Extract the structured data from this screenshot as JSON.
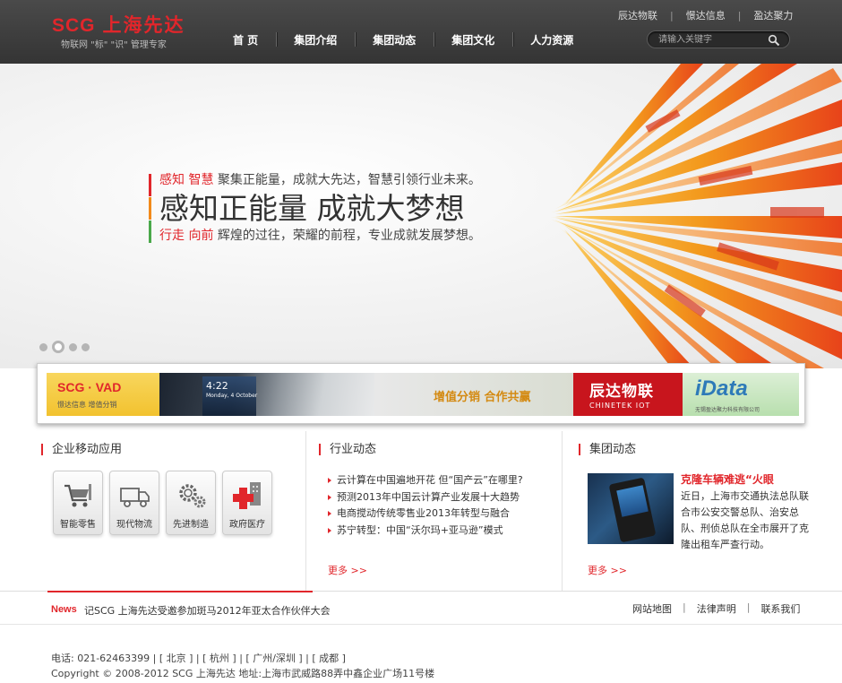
{
  "header": {
    "logo_main": "SCG",
    "logo_cn": "上海先达",
    "logo_sub": "物联网 \"标\" \"识\" 管理专家",
    "top_links": [
      "辰达物联",
      "憬达信息",
      "盈达聚力"
    ],
    "top_sep": "|",
    "nav": [
      "首 页",
      "集团介绍",
      "集团动态",
      "集团文化",
      "人力资源"
    ],
    "search_placeholder": "请输入关键字"
  },
  "banner": {
    "line1_red": "感知 智慧",
    "line1_rest": " 聚集正能量，成就大先达，智慧引领行业未来。",
    "line2": "感知正能量 成就大梦想",
    "line3_red": "行走 向前",
    "line3_rest": " 辉煌的过往，荣耀的前程，专业成就发展梦想。",
    "slide_count": 4,
    "active_slide": 2
  },
  "ad_strip": {
    "scg_line1": "SCG · VAD",
    "scg_line2": "憬达信息  增值分销",
    "phone_clock": "4:22",
    "phone_date": "Monday, 4 October",
    "slogan": "增值分销 合作共赢",
    "chinetek_cn": "辰达物联",
    "chinetek_en": "CHINETEK IOT",
    "idata_logo": "iData",
    "idata_sub": "无锡盈达聚力科技有限公司"
  },
  "sections": {
    "mobile_apps": {
      "title": "企业移动应用",
      "apps": [
        {
          "label": "智能零售",
          "icon": "cart-icon"
        },
        {
          "label": "现代物流",
          "icon": "truck-icon"
        },
        {
          "label": "先进制造",
          "icon": "gears-icon"
        },
        {
          "label": "政府医疗",
          "icon": "medical-cross-icon"
        }
      ]
    },
    "industry_news": {
      "title": "行业动态",
      "items": [
        "云计算在中国遍地开花 但“国产云”在哪里?",
        "预测2013年中国云计算产业发展十大趋势",
        "电商搅动传统零售业2013年转型与融合",
        "苏宁转型：中国“沃尔玛+亚马逊”模式"
      ],
      "more": "更多 >>"
    },
    "group_news": {
      "title": "集团动态",
      "headline": "克隆车辆难逃“火眼",
      "desc": "近日，上海市交通执法总队联合市公安交警总队、治安总队、刑侦总队在全市展开了克隆出租车严查行动。",
      "more": "更多 >>"
    }
  },
  "ticker": {
    "label": "News",
    "text": "记SCG 上海先达受邀参加斑马2012年亚太合作伙伴大会",
    "links": [
      "网站地图",
      "法律声明",
      "联系我们"
    ],
    "sep": "|"
  },
  "footer": {
    "phone_line": "电话: 021-62463399 | [ 北京 ] | [ 杭州 ] | [ 广州/深圳 ] | [ 成都 ]",
    "copyright": "Copyright © 2008-2012 SCG 上海先达  地址:上海市武威路88弄中鑫企业广场11号楼"
  },
  "colors": {
    "brand_red": "#e1262b",
    "header_bg": "#3c3c3c",
    "accent_orange": "#f28a1b",
    "accent_green": "#4aa84a"
  }
}
